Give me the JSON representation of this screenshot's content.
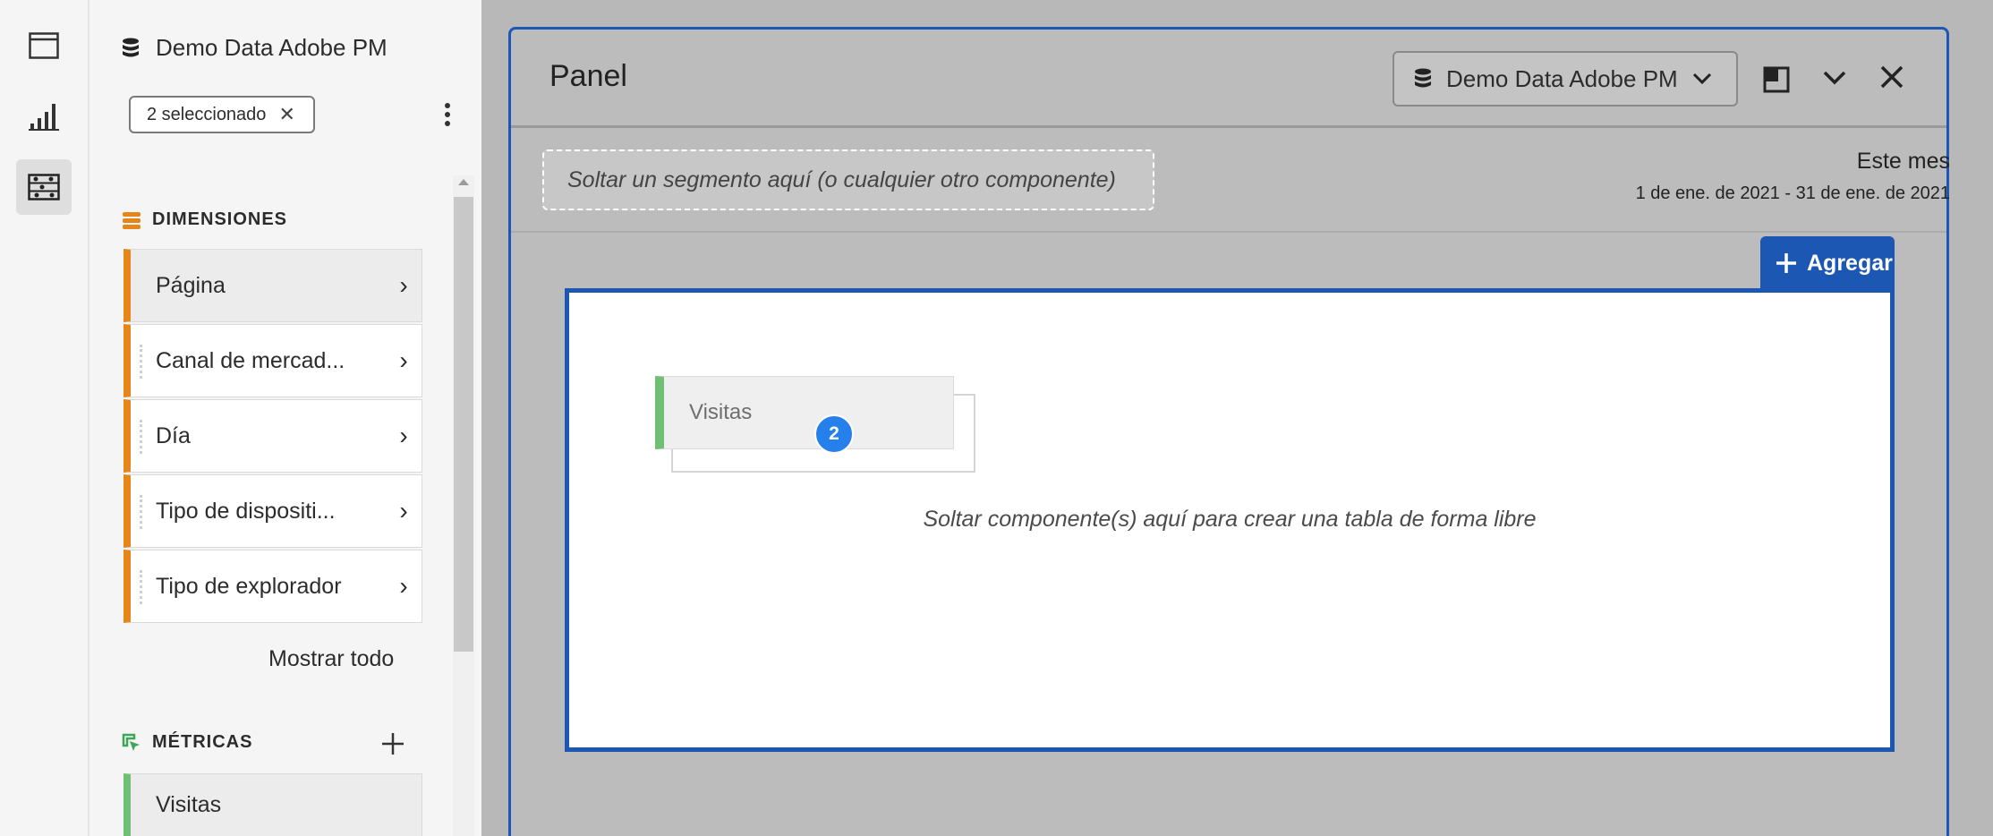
{
  "rail": {
    "items": [
      "panel-icon",
      "visualization-icon",
      "components-icon"
    ],
    "active": 2
  },
  "components": {
    "data_source": "Demo Data Adobe PM",
    "chip_label": "2 seleccionado",
    "dimensions_header": "DIMENSIONES",
    "dimensions": [
      {
        "label": "Página"
      },
      {
        "label": "Canal de mercad..."
      },
      {
        "label": "Día"
      },
      {
        "label": "Tipo de dispositi..."
      },
      {
        "label": "Tipo de explorador"
      }
    ],
    "show_all": "Mostrar todo",
    "metrics_header": "MÉTRICAS",
    "metrics": [
      {
        "label": "Visitas"
      }
    ]
  },
  "panel": {
    "title": "Panel",
    "data_source": "Demo Data Adobe PM",
    "segment_drop": "Soltar un segmento aquí (o cualquier otro componente)",
    "date_title": "Este mes",
    "date_range": "1 de ene. de 2021 - 31 de ene. de 2021",
    "add_label": "Agregar",
    "drag_item": "Visitas",
    "drag_count": "2",
    "drop_hint": "Soltar componente(s) aquí para crear una tabla de forma libre"
  },
  "colors": {
    "accent": "#1c57b3",
    "dimension": "#e68619",
    "metric": "#6fc073",
    "badge": "#2680eb"
  }
}
